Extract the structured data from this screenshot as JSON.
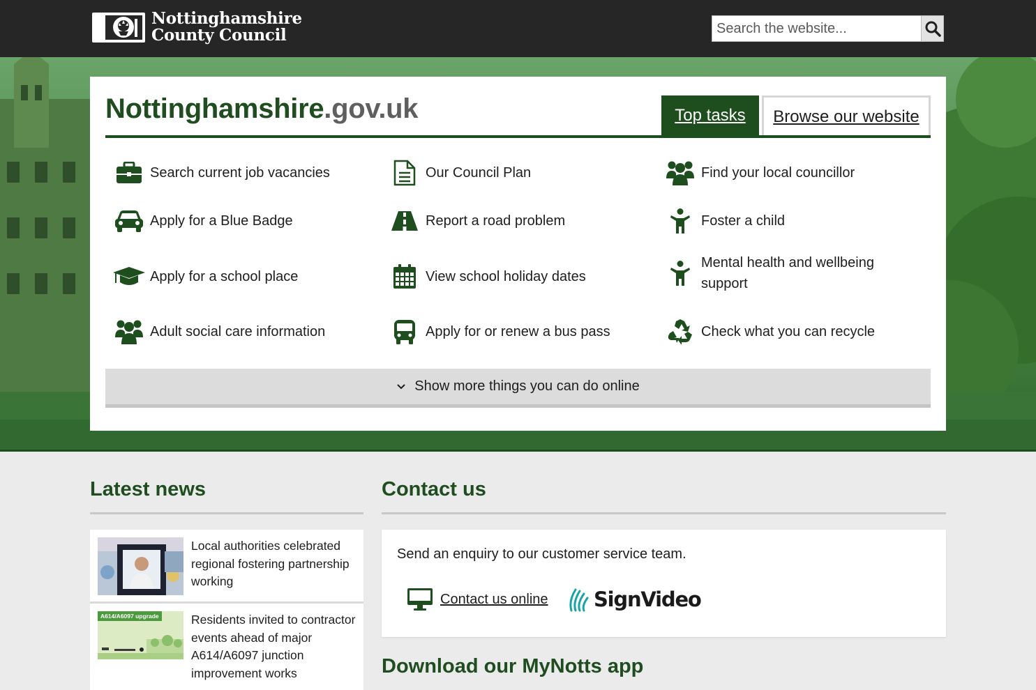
{
  "header": {
    "logo_line1": "Nottinghamshire",
    "logo_line2": "County Council",
    "search_placeholder": "Search the website...",
    "search_icon": "magnifier-icon"
  },
  "hero": {
    "title_main": "Nottinghamshire",
    "title_suffix": ".gov.uk",
    "tabs": [
      {
        "label": "Top tasks",
        "active": true
      },
      {
        "label": "Browse our website",
        "active": false
      }
    ],
    "tasks": [
      {
        "label": "Search current job vacancies",
        "icon": "briefcase-icon"
      },
      {
        "label": "Our Council Plan",
        "icon": "document-icon"
      },
      {
        "label": "Find your local councillor",
        "icon": "people-group-icon"
      },
      {
        "label": "Apply for a Blue Badge",
        "icon": "car-icon"
      },
      {
        "label": "Report a road problem",
        "icon": "road-icon"
      },
      {
        "label": "Foster a child",
        "icon": "child-icon"
      },
      {
        "label": "Apply for a school place",
        "icon": "graduation-cap-icon"
      },
      {
        "label": "View school holiday dates",
        "icon": "calendar-icon"
      },
      {
        "label": "Mental health and wellbeing support",
        "icon": "person-icon"
      },
      {
        "label": "Adult social care information",
        "icon": "people-group-icon"
      },
      {
        "label": "Apply for or renew a bus pass",
        "icon": "bus-icon"
      },
      {
        "label": "Check what you can recycle",
        "icon": "recycle-icon"
      }
    ],
    "show_more": "Show more things you can do online"
  },
  "news": {
    "title": "Latest news",
    "items": [
      {
        "title": "Local authorities celebrated regional fostering partnership working"
      },
      {
        "title": "Residents invited to contractor events ahead of major A614/A6097 junction improvement works",
        "thumb_caption": "A614/A6097 upgrade"
      }
    ]
  },
  "contact": {
    "title": "Contact us",
    "intro": "Send an enquiry to our customer service team.",
    "link_label": "Contact us online",
    "signvideo": "SignVideo"
  },
  "app": {
    "title": "Download our MyNotts app"
  },
  "colors": {
    "header_bg": "#262626",
    "brand_green": "#1e4d1e",
    "page_bg": "#ebebeb"
  }
}
